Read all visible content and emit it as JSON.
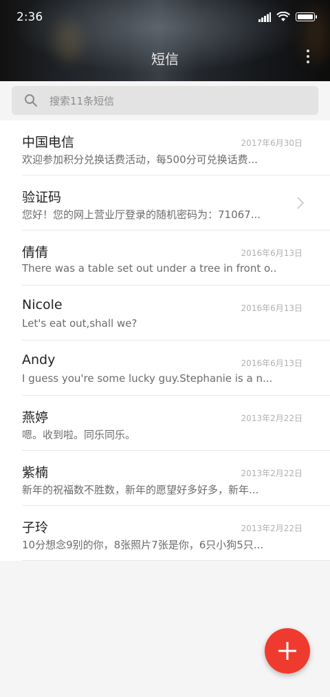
{
  "status_bar": {
    "time": "2:36"
  },
  "header": {
    "title": "短信"
  },
  "search": {
    "placeholder": "搜索11条短信"
  },
  "messages": [
    {
      "name": "中国电信",
      "preview": "欢迎参加积分兑换话费活动，每500分可兑换话费...",
      "date": "2017年6月30日"
    },
    {
      "name": "验证码",
      "preview": "您好！您的网上营业厅登录的随机密码为：71067...",
      "date": ""
    },
    {
      "name": "倩倩",
      "preview": "There was a table set out under a tree in front o...",
      "date": "2016年6月13日"
    },
    {
      "name": "Nicole",
      "preview": "Let's eat out,shall we?",
      "date": "2016年6月13日"
    },
    {
      "name": "Andy",
      "preview": "I guess you're some lucky guy.Stephanie is a n...",
      "date": "2016年6月13日"
    },
    {
      "name": "燕婷",
      "preview": "嗯。收到啦。同乐同乐。",
      "date": "2013年2月22日"
    },
    {
      "name": "紫楠",
      "preview": "新年的祝福数不胜数，新年的愿望好多好多，新年...",
      "date": "2013年2月22日"
    },
    {
      "name": "子玲",
      "preview": "10分想念9别的你，8张照片7张是你，6只小狗5只...",
      "date": "2013年2月22日"
    }
  ],
  "colors": {
    "fab": "#ef3b2f",
    "list_bg": "#ffffff",
    "page_bg": "#f5f5f5"
  },
  "icons": {
    "signal": "signal-icon",
    "wifi": "wifi-icon",
    "battery": "battery-icon",
    "more": "more-vertical-icon",
    "search": "search-icon",
    "chevron": "chevron-right-icon",
    "compose": "plus-icon"
  }
}
